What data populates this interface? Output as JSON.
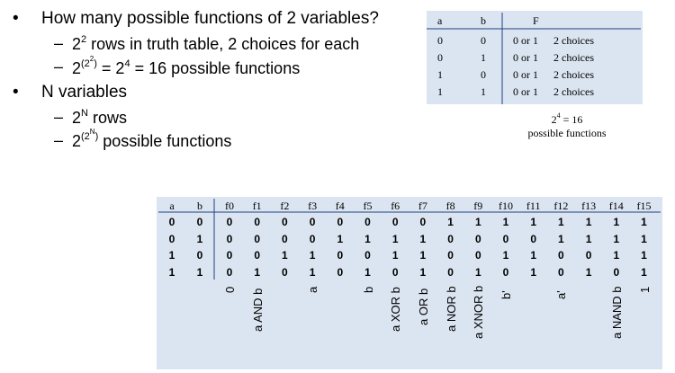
{
  "bullets": {
    "q1": "How many possible functions of 2 variables?",
    "q1_sub1": "2² rows in truth table, 2 choices for each",
    "q1_sub2": "2^(2^2) = 2^4 = 16 possible functions",
    "q2": "N variables",
    "q2_sub1": "2^N rows",
    "q2_sub2": "2^(2^N) possible functions"
  },
  "small_table": {
    "headers": [
      "a",
      "b",
      "F"
    ],
    "rows": [
      [
        "0",
        "0",
        "0 or 1",
        "2 choices"
      ],
      [
        "0",
        "1",
        "0 or 1",
        "2 choices"
      ],
      [
        "1",
        "0",
        "0 or 1",
        "2 choices"
      ],
      [
        "1",
        "1",
        "0 or 1",
        "2 choices"
      ]
    ],
    "caption_line1": "2⁴ = 16",
    "caption_line2": "possible functions"
  },
  "big_table": {
    "input_headers": [
      "a",
      "b"
    ],
    "inputs": [
      [
        "0",
        "0"
      ],
      [
        "0",
        "1"
      ],
      [
        "1",
        "0"
      ],
      [
        "1",
        "1"
      ]
    ],
    "function_headers": [
      "f0",
      "f1",
      "f2",
      "f3",
      "f4",
      "f5",
      "f6",
      "f7",
      "f8",
      "f9",
      "f10",
      "f11",
      "f12",
      "f13",
      "f14",
      "f15"
    ],
    "function_columns": [
      [
        "0",
        "0",
        "0",
        "0"
      ],
      [
        "0",
        "0",
        "0",
        "1"
      ],
      [
        "0",
        "0",
        "1",
        "0"
      ],
      [
        "0",
        "0",
        "1",
        "1"
      ],
      [
        "0",
        "1",
        "0",
        "0"
      ],
      [
        "0",
        "1",
        "0",
        "1"
      ],
      [
        "0",
        "1",
        "1",
        "0"
      ],
      [
        "0",
        "1",
        "1",
        "1"
      ],
      [
        "1",
        "0",
        "0",
        "0"
      ],
      [
        "1",
        "0",
        "0",
        "1"
      ],
      [
        "1",
        "0",
        "1",
        "0"
      ],
      [
        "1",
        "0",
        "1",
        "1"
      ],
      [
        "1",
        "1",
        "0",
        "0"
      ],
      [
        "1",
        "1",
        "0",
        "1"
      ],
      [
        "1",
        "1",
        "1",
        "0"
      ],
      [
        "1",
        "1",
        "1",
        "1"
      ]
    ],
    "function_names": [
      "0",
      "a AND b",
      "",
      "a",
      "",
      "b",
      "a XOR b",
      "a OR b",
      "a NOR b",
      "a XNOR b",
      "b'",
      "",
      "a'",
      "",
      "a NAND b",
      "1"
    ]
  },
  "colors": {
    "table_bg": "#dbe5f1",
    "rule": "#1f3f7f"
  }
}
